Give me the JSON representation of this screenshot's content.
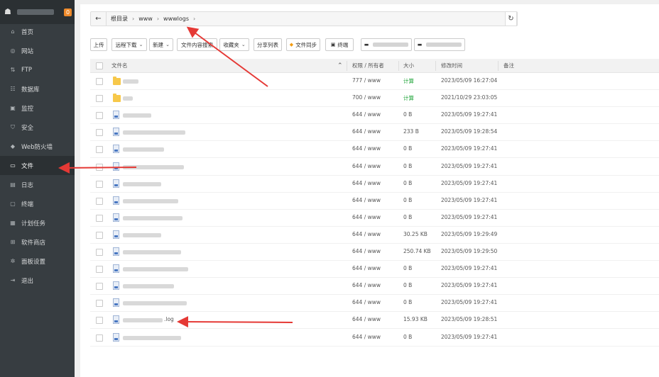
{
  "sidebar": {
    "badge": "0",
    "items": [
      {
        "label": "首页",
        "icon": "home-icon",
        "glyph": "⌂"
      },
      {
        "label": "网站",
        "icon": "globe-icon",
        "glyph": "◎"
      },
      {
        "label": "FTP",
        "icon": "ftp-icon",
        "glyph": "⇅"
      },
      {
        "label": "数据库",
        "icon": "database-icon",
        "glyph": "☷"
      },
      {
        "label": "监控",
        "icon": "monitor-icon",
        "glyph": "▣"
      },
      {
        "label": "安全",
        "icon": "shield-icon",
        "glyph": "⛉"
      },
      {
        "label": "Web防火墙",
        "icon": "firewall-icon",
        "glyph": "◆"
      },
      {
        "label": "文件",
        "icon": "folder-icon",
        "glyph": "▭"
      },
      {
        "label": "日志",
        "icon": "log-icon",
        "glyph": "▤"
      },
      {
        "label": "终端",
        "icon": "terminal-icon",
        "glyph": "▢"
      },
      {
        "label": "计划任务",
        "icon": "task-icon",
        "glyph": "▦"
      },
      {
        "label": "软件商店",
        "icon": "store-icon",
        "glyph": "⊞"
      },
      {
        "label": "面板设置",
        "icon": "gear-icon",
        "glyph": "✲"
      },
      {
        "label": "退出",
        "icon": "logout-icon",
        "glyph": "⇥"
      }
    ],
    "active_index": 7
  },
  "path": {
    "root": "根目录",
    "segments": [
      "www",
      "wwwlogs"
    ]
  },
  "toolbar": {
    "upload": "上传",
    "remote_download": "远程下载",
    "new": "新建",
    "content_search": "文件内容搜索",
    "favorites": "收藏夹",
    "share_list": "分享列表",
    "file_sync": "文件同步",
    "terminal": "终端"
  },
  "table": {
    "headers": {
      "name": "文件名",
      "perm": "权限 / 所有者",
      "size": "大小",
      "mtime": "修改时间",
      "note": "备注"
    },
    "rows": [
      {
        "type": "folder",
        "name": "",
        "perm": "777 / www",
        "size": "计算",
        "mtime": "2023/05/09 16:27:04"
      },
      {
        "type": "folder",
        "name": "",
        "perm": "700 / www",
        "size": "计算",
        "mtime": "2021/10/29 23:03:05"
      },
      {
        "type": "file",
        "name": "",
        "perm": "644 / www",
        "size": "0 B",
        "mtime": "2023/05/09 19:27:41"
      },
      {
        "type": "file",
        "name": "",
        "perm": "644 / www",
        "size": "233 B",
        "mtime": "2023/05/09 19:28:54"
      },
      {
        "type": "file",
        "name": "",
        "perm": "644 / www",
        "size": "0 B",
        "mtime": "2023/05/09 19:27:41"
      },
      {
        "type": "file",
        "name": "",
        "perm": "644 / www",
        "size": "0 B",
        "mtime": "2023/05/09 19:27:41"
      },
      {
        "type": "file",
        "name": "",
        "perm": "644 / www",
        "size": "0 B",
        "mtime": "2023/05/09 19:27:41"
      },
      {
        "type": "file",
        "name": "",
        "perm": "644 / www",
        "size": "0 B",
        "mtime": "2023/05/09 19:27:41"
      },
      {
        "type": "file",
        "name": "",
        "perm": "644 / www",
        "size": "0 B",
        "mtime": "2023/05/09 19:27:41"
      },
      {
        "type": "file",
        "name": "",
        "perm": "644 / www",
        "size": "30.25 KB",
        "mtime": "2023/05/09 19:29:49"
      },
      {
        "type": "file",
        "name": "",
        "perm": "644 / www",
        "size": "250.74 KB",
        "mtime": "2023/05/09 19:29:50"
      },
      {
        "type": "file",
        "name": "",
        "perm": "644 / www",
        "size": "0 B",
        "mtime": "2023/05/09 19:27:41"
      },
      {
        "type": "file",
        "name": "",
        "perm": "644 / www",
        "size": "0 B",
        "mtime": "2023/05/09 19:27:41"
      },
      {
        "type": "file",
        "name": "",
        "perm": "644 / www",
        "size": "0 B",
        "mtime": "2023/05/09 19:27:41"
      },
      {
        "type": "file",
        "name": ".log",
        "perm": "644 / www",
        "size": "15.93 KB",
        "mtime": "2023/05/09 19:28:51"
      },
      {
        "type": "file",
        "name": "",
        "perm": "644 / www",
        "size": "0 B",
        "mtime": "2023/05/09 19:27:41"
      }
    ]
  },
  "colors": {
    "sidebar_bg": "#373d41",
    "accent_green": "#20a53a",
    "badge": "#ef8a2a",
    "annotation_arrow": "#e53935"
  }
}
